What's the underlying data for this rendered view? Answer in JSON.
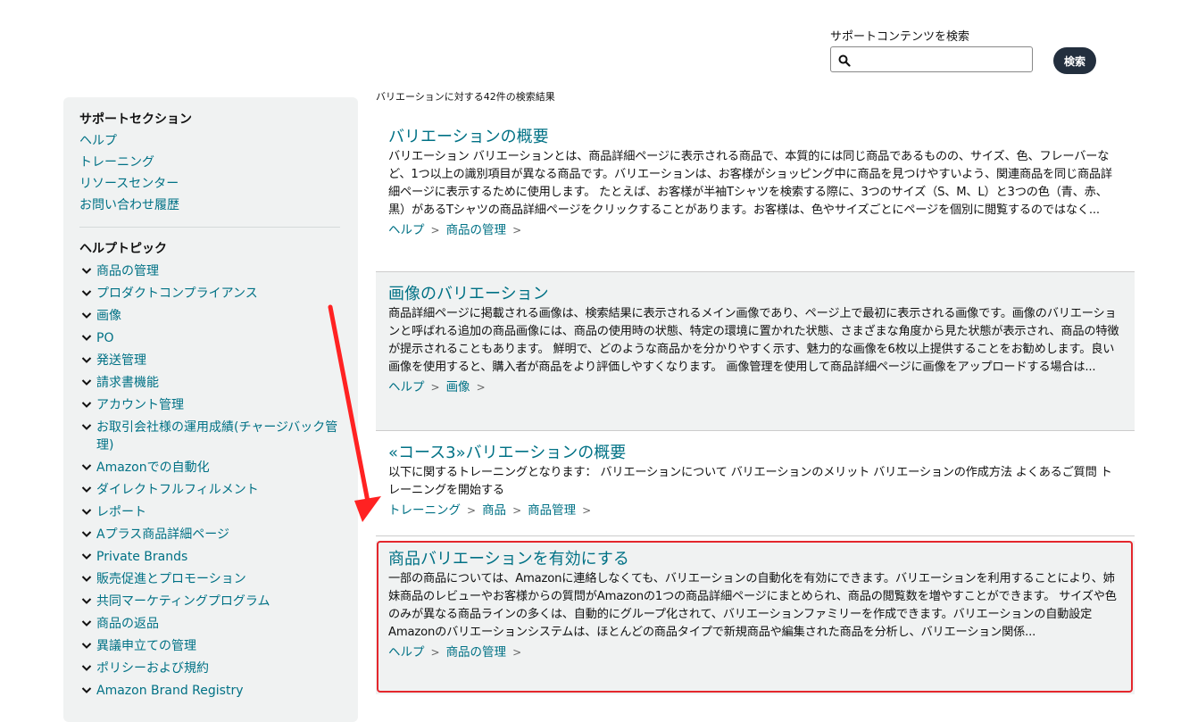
{
  "search": {
    "label": "サポートコンテンツを検索",
    "placeholder": "",
    "value": "",
    "button": "検索",
    "icon": "search-icon"
  },
  "sidebar": {
    "support_heading": "サポートセクション",
    "support_links": [
      "ヘルプ",
      "トレーニング",
      "リソースセンター",
      "お問い合わせ履歴"
    ],
    "topics_heading": "ヘルプトピック",
    "topics": [
      "商品の管理",
      "プロダクトコンプライアンス",
      "画像",
      "PO",
      "発送管理",
      "請求書機能",
      "アカウント管理",
      "お取引会社様の運用成績(チャージバック管理)",
      "Amazonでの自動化",
      "ダイレクトフルフィルメント",
      "レポート",
      "Aプラス商品詳細ページ",
      "Private Brands",
      "販売促進とプロモーション",
      "共同マーケティングプログラム",
      "商品の返品",
      "異議申立ての管理",
      "ポリシーおよび規約",
      "Amazon Brand Registry"
    ]
  },
  "results": {
    "count_text": "バリエーションに対する42件の検索結果",
    "items": [
      {
        "title": "バリエーションの概要",
        "body": "バリエーション バリエーションとは、商品詳細ページに表示される商品で、本質的には同じ商品であるものの、サイズ、色、フレーバーなど、1つ以上の識別項目が異なる商品です。バリエーションは、お客様がショッピング中に商品を見つけやすいよう、関連商品を同じ商品詳細ページに表示するために使用します。 たとえば、お客様が半袖Tシャツを検索する際に、3つのサイズ（S、M、L）と3つの色（青、赤、黒）があるTシャツの商品詳細ページをクリックすることがあります。お客様は、色やサイズごとにページを個別に閲覧するのではなく...",
        "breadcrumb": [
          "ヘルプ",
          "商品の管理"
        ]
      },
      {
        "title": "画像のバリエーション",
        "body": "商品詳細ページに掲載される画像は、検索結果に表示されるメイン画像であり、ページ上で最初に表示される画像です。画像のバリエーションと呼ばれる追加の商品画像には、商品の使用時の状態、特定の環境に置かれた状態、さまざまな角度から見た状態が表示され、商品の特徴が提示されることもあります。 鮮明で、どのような商品かを分かりやすく示す、魅力的な画像を6枚以上提供することをお勧めします。良い画像を使用すると、購入者が商品をより評価しやすくなります。 画像管理を使用して商品詳細ページに画像をアップロードする場合は...",
        "breadcrumb": [
          "ヘルプ",
          "画像"
        ]
      },
      {
        "title": "«コース3»バリエーションの概要",
        "body": "以下に関するトレーニングとなります： バリエーションについて バリエーションのメリット バリエーションの作成方法 よくあるご質問 トレーニングを開始する",
        "breadcrumb": [
          "トレーニング",
          "商品",
          "商品管理"
        ]
      },
      {
        "title": "商品バリエーションを有効にする",
        "body": "一部の商品については、Amazonに連絡しなくても、バリエーションの自動化を有効にできます。バリエーションを利用することにより、姉妹商品のレビューやお客様からの質問がAmazonの1つの商品詳細ページにまとめられ、商品の閲覧数を増やすことができます。 サイズや色のみが異なる商品ラインの多くは、自動的にグループ化されて、バリエーションファミリーを作成できます。バリエーションの自動設定 Amazonのバリエーションシステムは、ほとんどの商品タイプで新規商品や編集された商品を分析し、バリエーション関係...",
        "breadcrumb": [
          "ヘルプ",
          "商品の管理"
        ]
      }
    ]
  },
  "colors": {
    "link": "#007185",
    "sidebar_bg": "#f0f2f2",
    "button_bg": "#232f3e",
    "annotation_red": "#e4272d"
  }
}
